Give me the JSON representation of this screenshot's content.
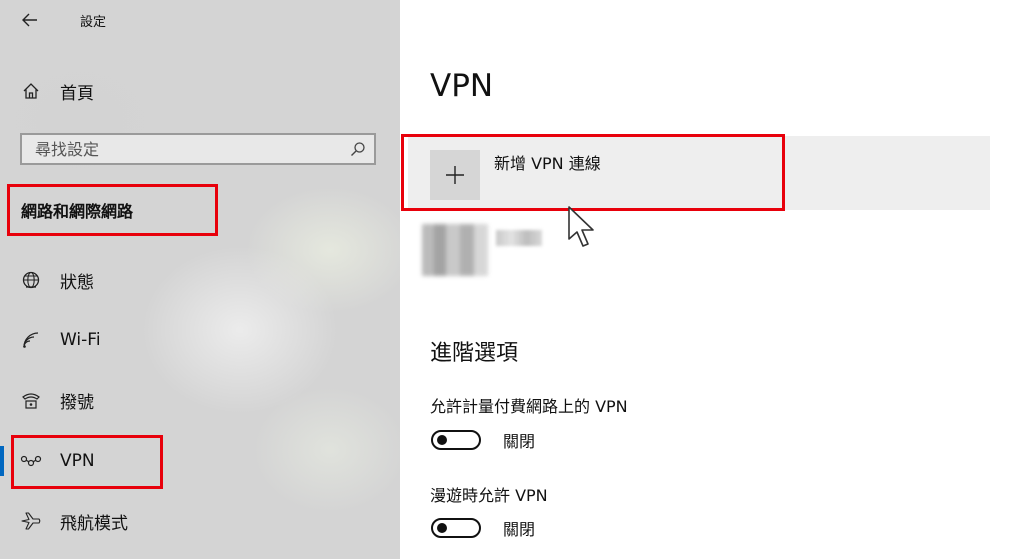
{
  "window": {
    "title": "設定"
  },
  "sidebar": {
    "home_label": "首頁",
    "search_placeholder": "尋找設定",
    "section_heading": "網路和網際網路",
    "items": [
      {
        "label": "狀態",
        "icon": "globe-icon"
      },
      {
        "label": "Wi-Fi",
        "icon": "wifi-icon"
      },
      {
        "label": "撥號",
        "icon": "dialup-icon"
      },
      {
        "label": "VPN",
        "icon": "vpn-icon",
        "selected": true
      },
      {
        "label": "飛航模式",
        "icon": "airplane-icon"
      }
    ],
    "accent_color": "#0067c0"
  },
  "main": {
    "title": "VPN",
    "add_vpn_label": "新增 VPN 連線",
    "advanced_heading": "進階選項",
    "settings": [
      {
        "label": "允許計量付費網路上的 VPN",
        "state": "關閉",
        "on": false
      },
      {
        "label": "漫遊時允許 VPN",
        "state": "關閉",
        "on": false
      }
    ]
  },
  "annotations": {
    "highlight_color": "#e8000b"
  }
}
